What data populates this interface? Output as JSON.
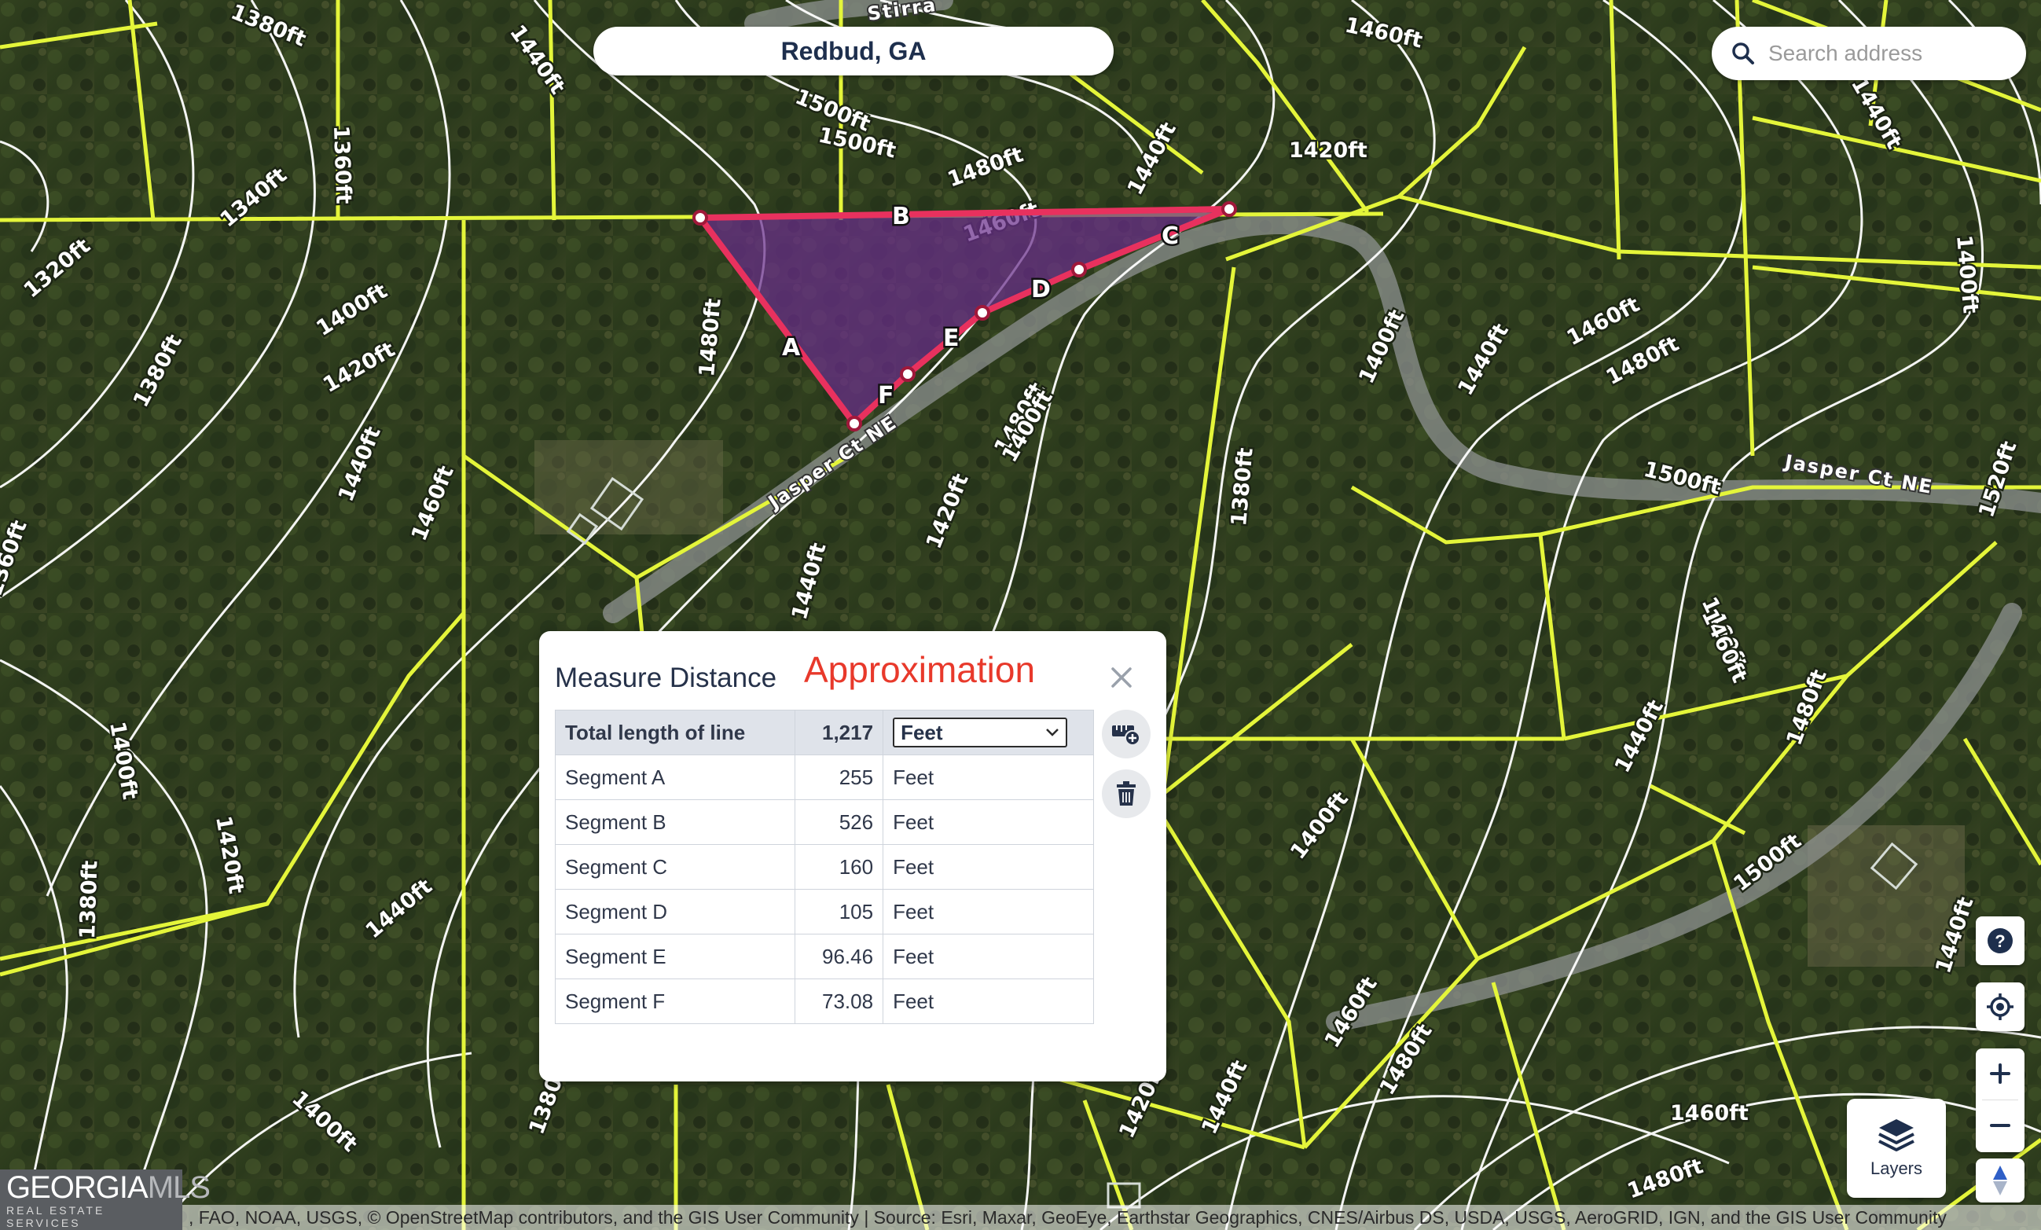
{
  "location": {
    "title": "Redbud, GA"
  },
  "search": {
    "placeholder": "Search address"
  },
  "measure": {
    "title": "Measure Distance",
    "subtitle": "Approximation",
    "total_label": "Total length of line",
    "total_value": "1,217",
    "unit_selected": "Feet",
    "segments": [
      {
        "label": "Segment A",
        "value": "255",
        "unit": "Feet"
      },
      {
        "label": "Segment B",
        "value": "526",
        "unit": "Feet"
      },
      {
        "label": "Segment C",
        "value": "160",
        "unit": "Feet"
      },
      {
        "label": "Segment D",
        "value": "105",
        "unit": "Feet"
      },
      {
        "label": "Segment E",
        "value": "96.46",
        "unit": "Feet"
      },
      {
        "label": "Segment F",
        "value": "73.08",
        "unit": "Feet"
      }
    ],
    "vertex_labels": [
      "A",
      "B",
      "C",
      "D",
      "E",
      "F"
    ],
    "polygon_color": "#e8315e",
    "polygon_fill": "#6a2e8a"
  },
  "map": {
    "contour_labels": [
      "1380ft",
      "1440ft",
      "1360ft",
      "1340ft",
      "1320ft",
      "1380ft",
      "1400ft",
      "1420ft",
      "1440ft",
      "1460ft",
      "1360ft",
      "1400ft",
      "1420ft",
      "1380ft",
      "1440ft",
      "1500ft",
      "1480ft",
      "1460ft",
      "1480ft",
      "1440ft",
      "1420ft",
      "1460ft",
      "1480ft",
      "1500ft",
      "1400ft",
      "1440ft",
      "1460ft",
      "1480ft",
      "1500ft",
      "1520ft",
      "1420ft",
      "1440ft",
      "1400ft",
      "1380ft",
      "1400ft",
      "1440ft",
      "1460ft",
      "1480ft",
      "1400ft",
      "1460ft",
      "1480ft",
      "1500ft",
      "1440ft",
      "1420ft",
      "1440ft",
      "1460ft",
      "1480ft",
      "1400ft",
      "1380ft",
      "1460ft",
      "1440ft"
    ],
    "road_labels": [
      "Jasper Ct NE",
      "Jasper Ct NE",
      "Stirra"
    ],
    "parcel_color": "#e4f53a",
    "contour_color": "#ffffff"
  },
  "controls": {
    "help_icon": "help-icon",
    "locate_icon": "locate-icon",
    "zoom_in_icon": "plus-icon",
    "zoom_out_icon": "minus-icon",
    "compass_icon": "compass-icon",
    "layers_label": "Layers"
  },
  "attribution": ", FAO, NOAA, USGS, © OpenStreetMap contributors, and the GIS User Community | Source: Esri, Maxar, GeoEye, Earthstar Geographics, CNES/Airbus DS, USDA, USGS, AeroGRID, IGN, and the GIS User Community",
  "brand": {
    "name_a": "GEORGIA",
    "name_b": "MLS",
    "tagline": "REAL ESTATE SERVICES"
  }
}
